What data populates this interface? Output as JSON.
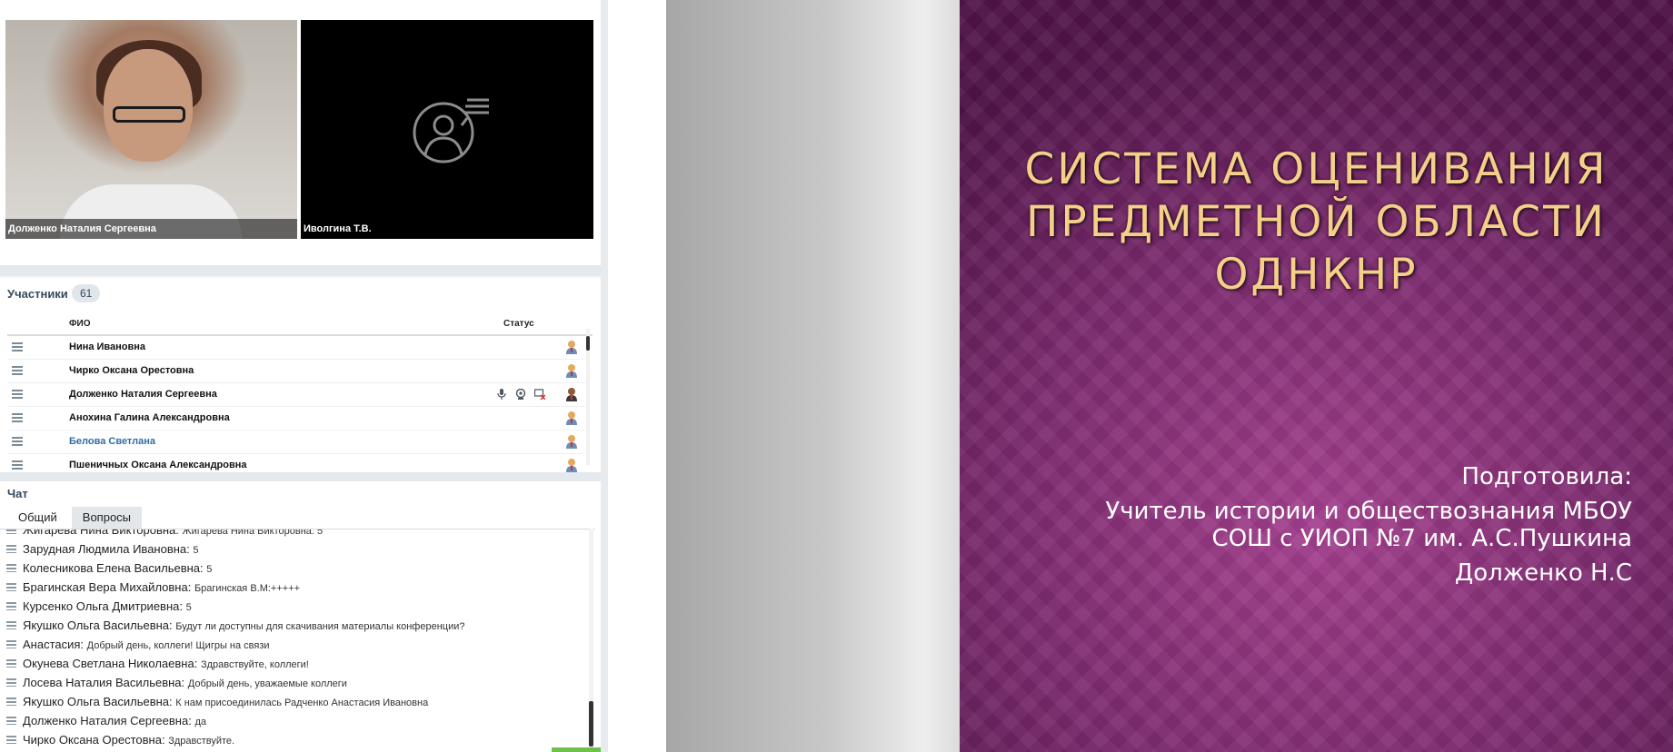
{
  "videos": [
    {
      "name": "Долженко Наталия Сергеевна"
    },
    {
      "name": "Иволгина Т.В."
    }
  ],
  "participants": {
    "title": "Участники",
    "count": "61",
    "col_name": "ФИО",
    "col_status": "Статус",
    "rows": [
      {
        "name": "Нина Ивановна"
      },
      {
        "name": "Чирко  Оксана Орестовна"
      },
      {
        "name": "Долженко Наталия Сергеевна"
      },
      {
        "name": "Анохина  Галина Александровна"
      },
      {
        "name": "Белова Светлана"
      },
      {
        "name": "Пшеничных Оксана  Александровна"
      }
    ]
  },
  "chat": {
    "title": "Чат",
    "tabs": [
      "Общий",
      "Вопросы"
    ],
    "messages": [
      {
        "author": "Жигарева Нина Викторовна:",
        "text": "Жигарева Нина Викторовна: 5"
      },
      {
        "author": "Зарудная Людмила  Ивановна:",
        "text": "5"
      },
      {
        "author": "Колесникова Елена  Васильевна:",
        "text": "5"
      },
      {
        "author": "Брагинская Вера  Михайловна:",
        "text": "Брагинская В.М:+++++"
      },
      {
        "author": "Курсенко Ольга  Дмитриевна:",
        "text": "5"
      },
      {
        "author": "Якушко Ольга  Васильевна:",
        "text": "Будут ли доступны для скачивания материалы конференции?"
      },
      {
        "author": "Анастасия:",
        "text": "Добрый день, коллеги! Щигры на связи"
      },
      {
        "author": "Окунева Светлана  Николаевна:",
        "text": "Здравствуйте, коллеги!"
      },
      {
        "author": "Лосева Наталия Васильевна:",
        "text": "Добрый день, уважаемые коллеги"
      },
      {
        "author": "Якушко Ольга  Васильевна:",
        "text": "К нам присоединилась Радченко Анастасия Ивановна"
      },
      {
        "author": "Долженко Наталия Сергеевна:",
        "text": "да"
      },
      {
        "author": "Чирко  Оксана Орестовна:",
        "text": "Здравствуйте."
      }
    ]
  },
  "slide": {
    "title_lines": [
      "СИСТЕМА ОЦЕНИВАНИЯ",
      "ПРЕДМЕТНОЙ ОБЛАСТИ",
      "ОДНКНР"
    ],
    "prepared_label": "Подготовила:",
    "author_lines": [
      "Учитель истории и обществознания МБОУ",
      "СОШ с УИОП №7 им. А.С.Пушкина",
      "Долженко Н.С"
    ]
  },
  "colors": {
    "slide_bg": "#8a2f7c",
    "title_color": "#f5cf8a",
    "link_color": "#2e6da4",
    "accent_green": "#6cc24a"
  },
  "icons": [
    "microphone-icon",
    "webcam-icon",
    "screen-share-off-icon",
    "user-role-icon",
    "drag-handle-icon"
  ]
}
